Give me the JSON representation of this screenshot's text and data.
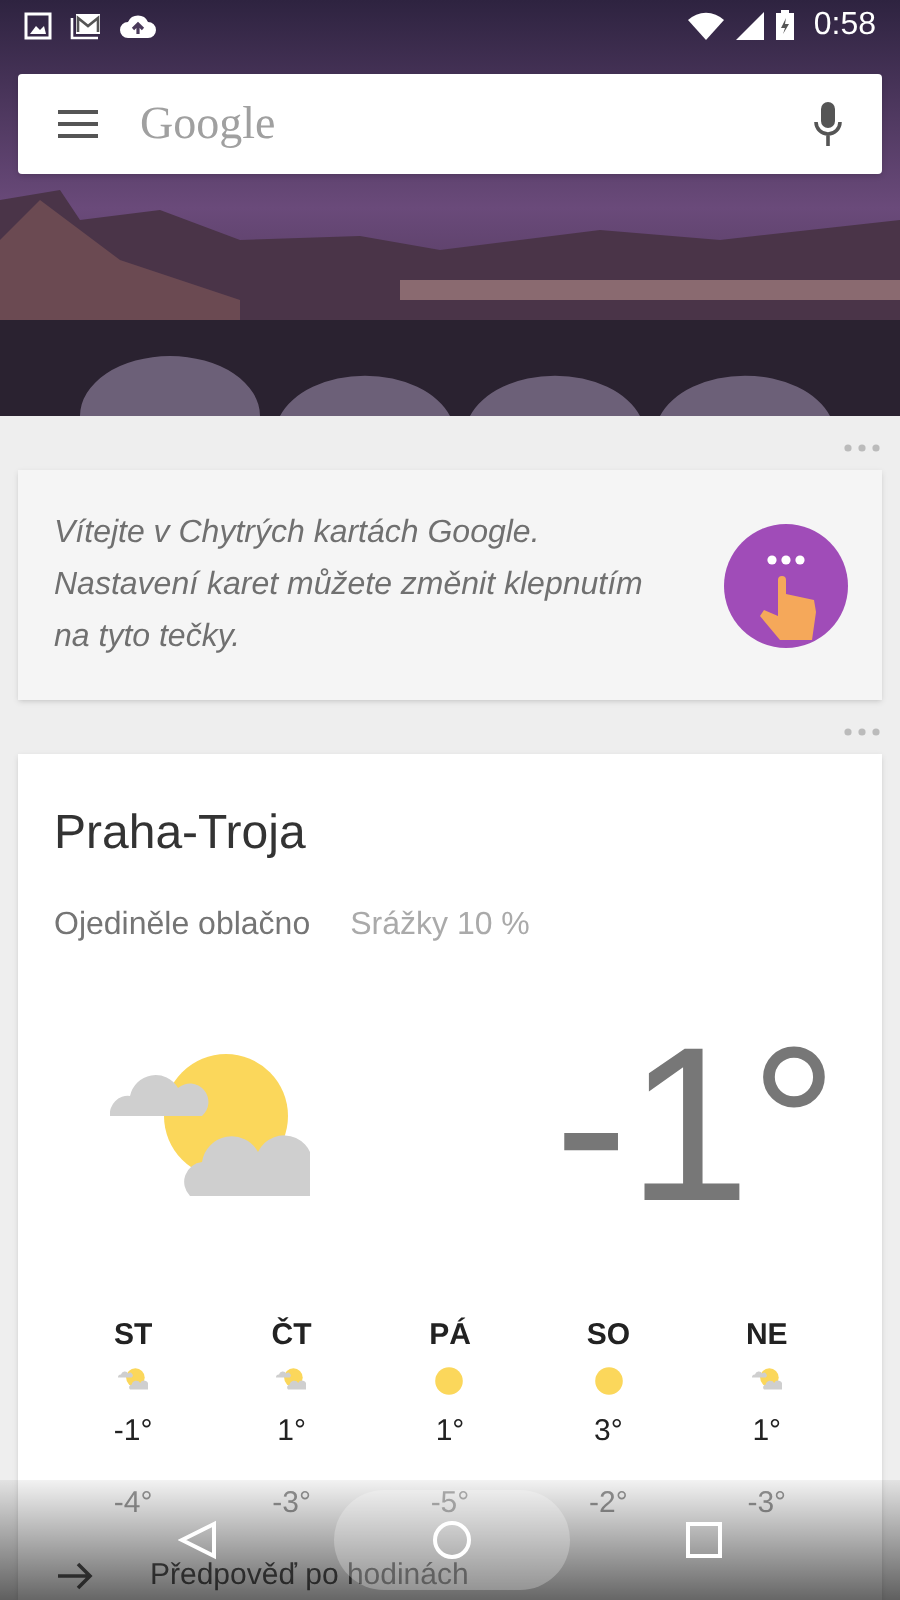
{
  "status_bar": {
    "time": "0:58"
  },
  "search": {
    "placeholder": "Google"
  },
  "welcome_card": {
    "text": "Vítejte v Chytrých kartách Google. Nastavení karet můžete změnit klepnutím na tyto tečky."
  },
  "weather_card": {
    "location": "Praha-Troja",
    "condition": "Ojediněle oblačno",
    "precipitation": "Srážky 10 %",
    "current": {
      "kind": "partly_cloudy",
      "temperature": "-1°"
    },
    "forecast": [
      {
        "day": "ST",
        "kind": "partly_cloudy",
        "high": "-1°",
        "low": "-4°"
      },
      {
        "day": "ČT",
        "kind": "partly_cloudy",
        "high": "1°",
        "low": "-3°"
      },
      {
        "day": "PÁ",
        "kind": "sunny",
        "high": "1°",
        "low": "-5°"
      },
      {
        "day": "SO",
        "kind": "sunny",
        "high": "3°",
        "low": "-2°"
      },
      {
        "day": "NE",
        "kind": "partly_cloudy",
        "high": "1°",
        "low": "-3°"
      }
    ],
    "link": "Předpověď po hodinách"
  }
}
